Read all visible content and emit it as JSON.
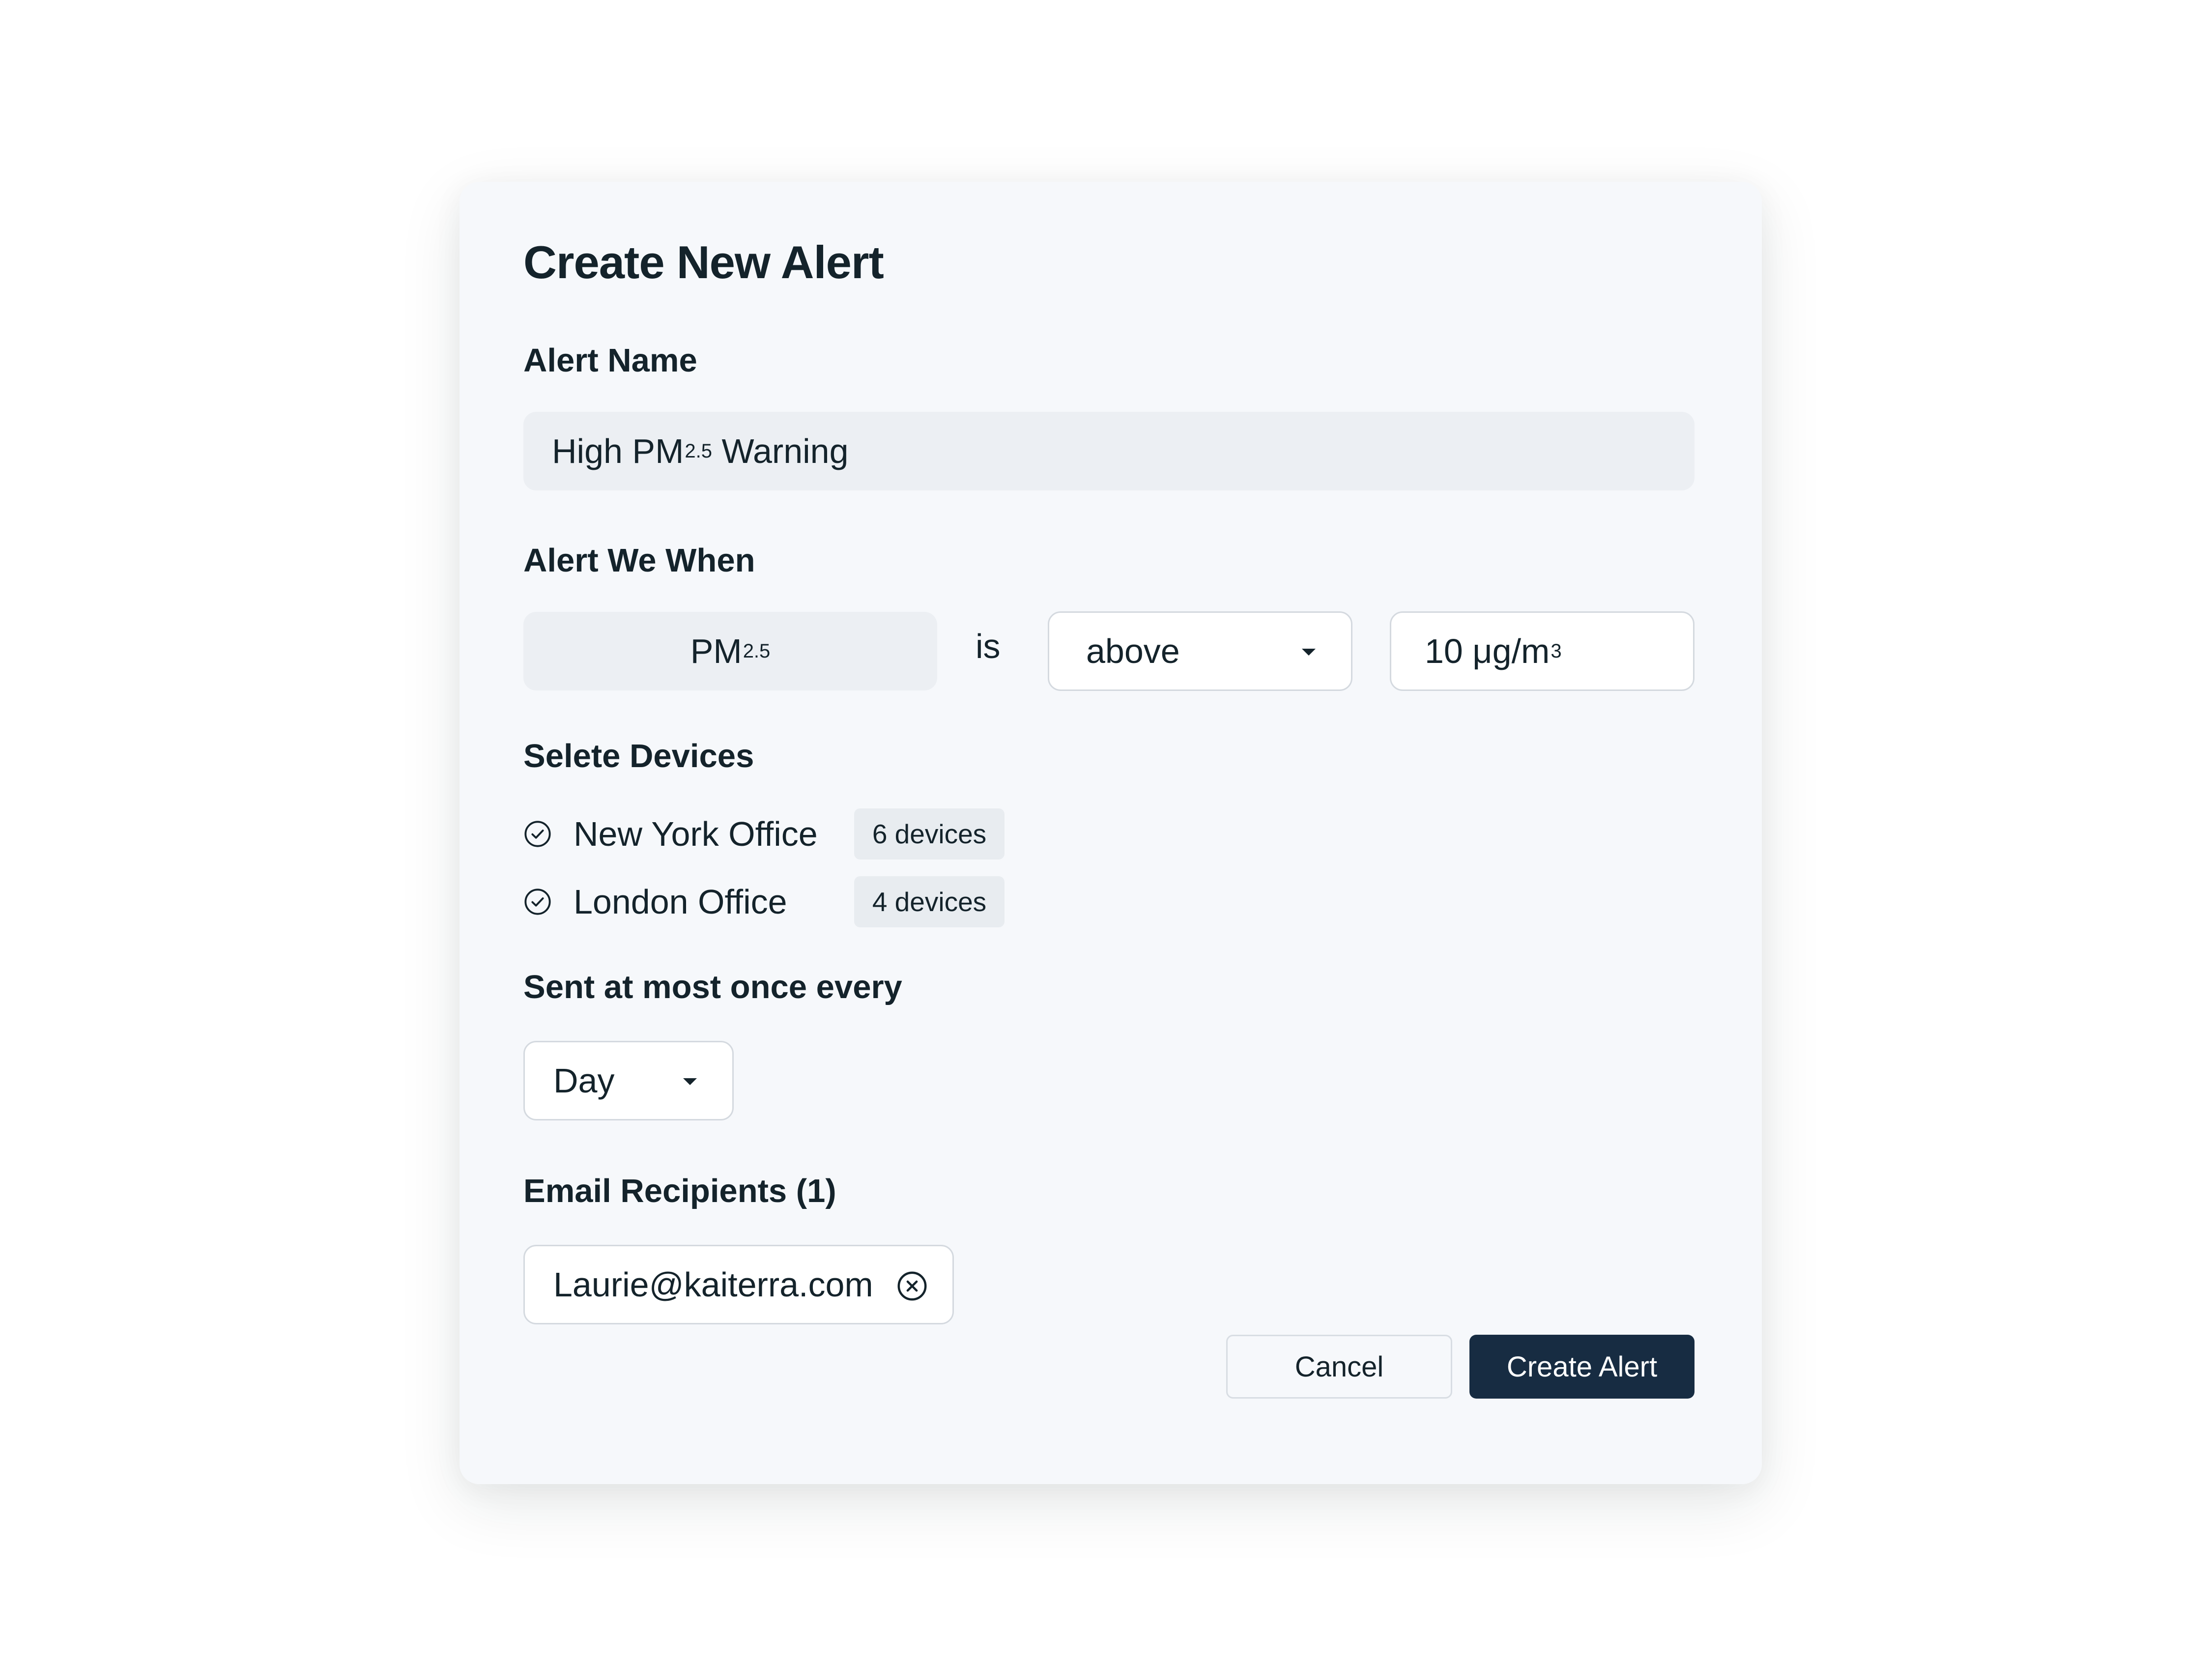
{
  "dialog": {
    "title": "Create New Alert"
  },
  "alert_name": {
    "label": "Alert Name",
    "value_prefix": "High PM",
    "value_subscript": "2.5",
    "value_suffix": " Warning"
  },
  "condition": {
    "label": "Alert We When",
    "metric": "PM",
    "metric_subscript": "2.5",
    "connector": "is",
    "operator": "above",
    "threshold_value": "10 μg/m",
    "threshold_superscript": "3"
  },
  "devices": {
    "label": "Selete Devices",
    "items": [
      {
        "name": "New York Office",
        "count": "6 devices"
      },
      {
        "name": "London Office",
        "count": "4 devices"
      }
    ]
  },
  "frequency": {
    "label": "Sent at most once every",
    "value": "Day"
  },
  "email": {
    "label": "Email Recipients (1)",
    "recipients": [
      "Laurie@kaiterra.com"
    ]
  },
  "actions": {
    "cancel_label": "Cancel",
    "create_label": "Create Alert"
  },
  "icons": {
    "check": "check-circle-icon",
    "remove": "close-circle-icon",
    "dropdown": "caret-down-icon"
  },
  "colors": {
    "card_background": "#f6f8fb",
    "filled_field": "#eceff3",
    "primary_button": "#172c42",
    "text": "#14232b"
  }
}
